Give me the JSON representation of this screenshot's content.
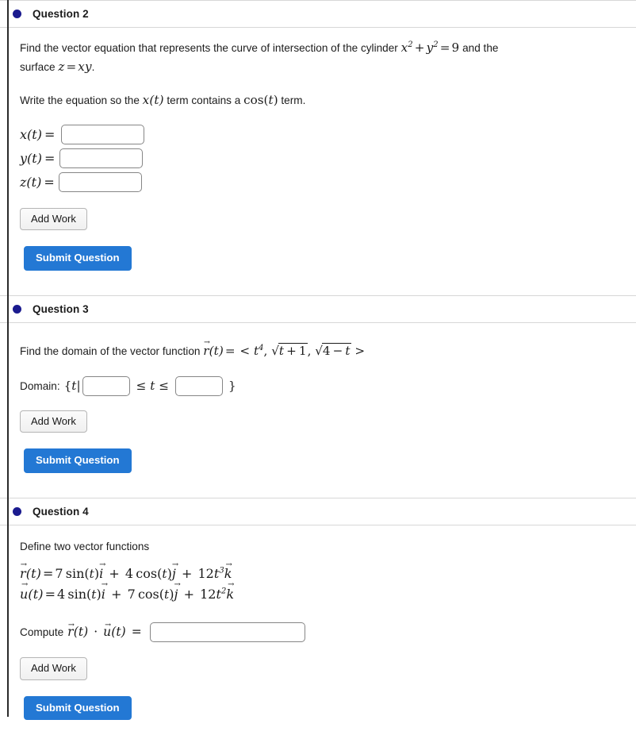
{
  "page": {
    "accent_blue": "#2378d4",
    "bullet_color": "#1b1b8f",
    "rule_color": "#d7d7d7"
  },
  "questions": [
    {
      "id": "q2",
      "title": "Question 2",
      "prompt_line1_a": "Find the vector equation that represents the curve of intersection of the cylinder ",
      "prompt_line1_math": "x² + y² = 9",
      "prompt_line1_b": " and the",
      "prompt_line2_a": "surface ",
      "prompt_line2_math": "z = xy",
      "prompt_line2_b": ".",
      "prompt2_a": "Write the equation so the ",
      "prompt2_math1": "x(t)",
      "prompt2_b": " term contains a ",
      "prompt2_math2": "cos(t)",
      "prompt2_c": " term.",
      "fields": [
        {
          "label_fn": "x(t)",
          "eq": "=",
          "value": "",
          "placeholder": ""
        },
        {
          "label_fn": "y(t)",
          "eq": "=",
          "value": "",
          "placeholder": ""
        },
        {
          "label_fn": "z(t)",
          "eq": "=",
          "value": "",
          "placeholder": ""
        }
      ],
      "add_work_label": "Add Work",
      "submit_label": "Submit Question"
    },
    {
      "id": "q3",
      "title": "Question 3",
      "prompt_a": "Find the domain of the vector function ",
      "prompt_math_fn": "r(t)",
      "prompt_math_eq": "=",
      "prompt_math_set": "< t⁴, √(t+1), √(4−t) >",
      "domain_label": "Domain:",
      "domain_open": "{t|",
      "domain_mid": "≤ t ≤",
      "domain_close": "}",
      "lower_value": "",
      "upper_value": "",
      "add_work_label": "Add Work",
      "submit_label": "Submit Question"
    },
    {
      "id": "q4",
      "title": "Question 4",
      "prompt": "Define two vector functions",
      "eq_r": "r(t) = 7 sin(t)i + 4 cos(t)j + 12t³k",
      "eq_u": "u(t) = 4 sin(t)i + 7 cos(t)j + 12t²k",
      "r_coef_sin": "7",
      "r_coef_cos": "4",
      "r_coef_k": "12",
      "r_pow_k": "3",
      "u_coef_sin": "4",
      "u_coef_cos": "7",
      "u_coef_k": "12",
      "u_pow_k": "2",
      "compute_label": "Compute",
      "compute_math": "r(t) · u(t) =",
      "compute_value": "",
      "add_work_label": "Add Work",
      "submit_label": "Submit Question"
    }
  ]
}
